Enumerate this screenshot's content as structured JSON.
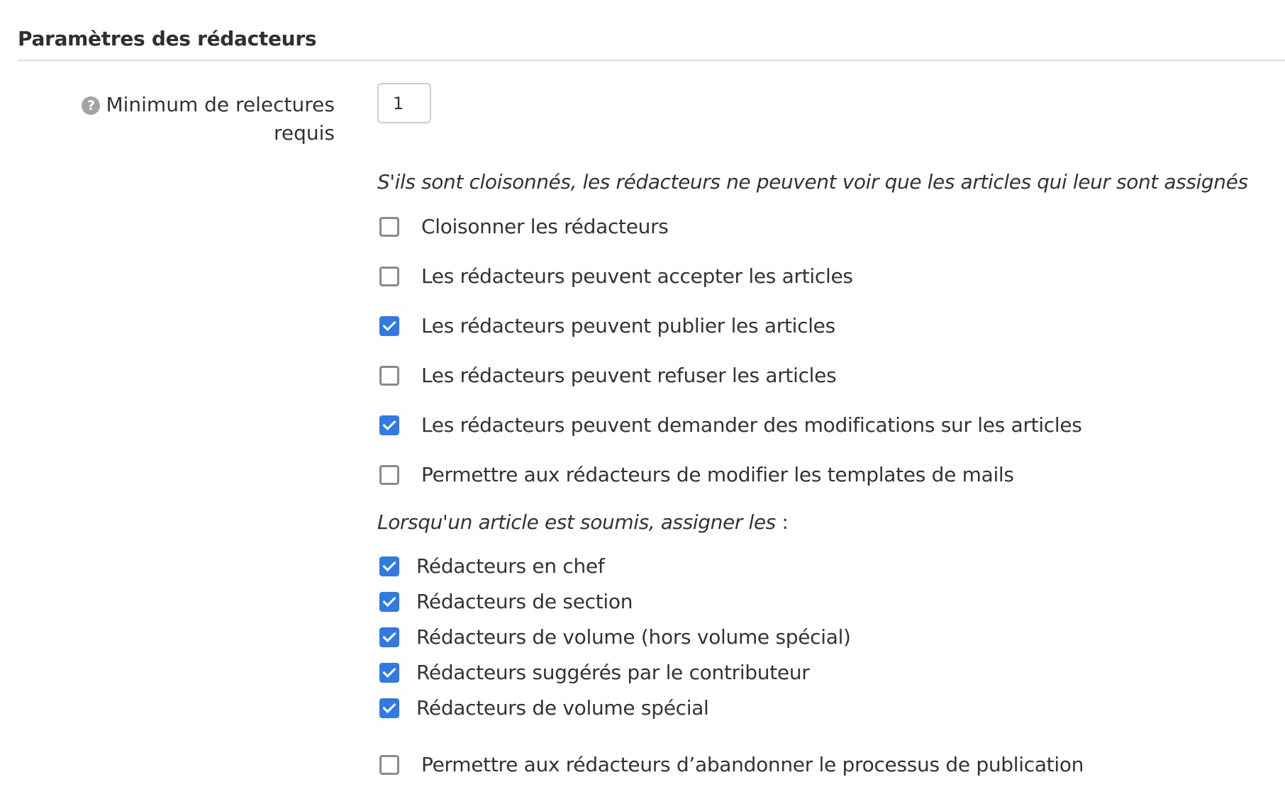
{
  "section": {
    "title": "Paramètres des rédacteurs"
  },
  "min_reviews": {
    "label": "Minimum de relectures requis",
    "value": "1",
    "help_icon": "question-circle-icon"
  },
  "compartment_hint": "S'ils sont cloisonnés, les rédacteurs ne peuvent voir que les articles qui leur sont assignés",
  "permissions": [
    {
      "label": "Cloisonner les rédacteurs",
      "checked": false
    },
    {
      "label": "Les rédacteurs peuvent accepter les articles",
      "checked": false
    },
    {
      "label": "Les rédacteurs peuvent publier les articles",
      "checked": true
    },
    {
      "label": "Les rédacteurs peuvent refuser les articles",
      "checked": false
    },
    {
      "label": "Les rédacteurs peuvent demander des modifications sur les articles",
      "checked": true
    },
    {
      "label": "Permettre aux rédacteurs de modifier les templates de mails",
      "checked": false
    }
  ],
  "assign": {
    "intro": "Lorsqu'un article est soumis, assigner les",
    "suffix": " :",
    "options": [
      {
        "label": "Rédacteurs en chef",
        "checked": true
      },
      {
        "label": "Rédacteurs de section",
        "checked": true
      },
      {
        "label": "Rédacteurs de volume (hors volume spécial)",
        "checked": true
      },
      {
        "label": "Rédacteurs suggérés par le contributeur",
        "checked": true
      },
      {
        "label": "Rédacteurs de volume spécial",
        "checked": true
      }
    ]
  },
  "abandon": {
    "label": "Permettre aux rédacteurs d’abandonner le processus de publication",
    "checked": false
  },
  "colors": {
    "checkbox_checked": "#2f7ae5",
    "checkbox_border": "#8a8a8a",
    "help_icon": "#a3a3a3",
    "divider": "#dcdcdc"
  }
}
